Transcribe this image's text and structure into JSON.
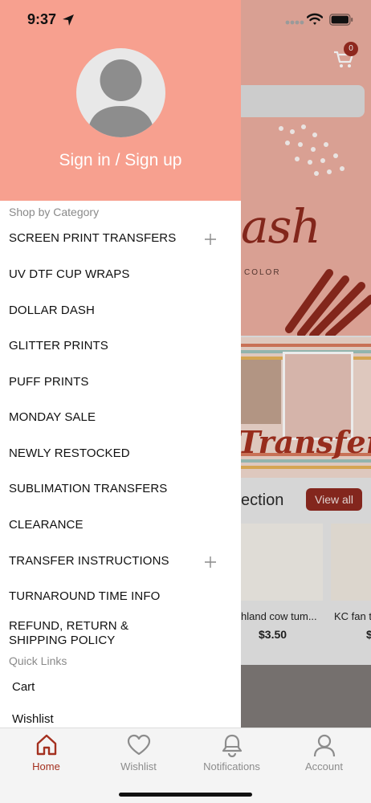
{
  "status_bar": {
    "time": "9:37"
  },
  "background": {
    "cart_badge": "0",
    "banner_word": "ash",
    "banner_subtext": "COLOR",
    "transfers_word": "Transfers",
    "section_title": "ection",
    "view_all_label": "View all",
    "products": [
      {
        "name": "hland cow tum...",
        "price": "$3.50"
      },
      {
        "name": "KC fan t",
        "price": "$"
      }
    ]
  },
  "drawer": {
    "sign_in_label": "Sign in / Sign up",
    "shop_by_category_label": "Shop by Category",
    "categories": [
      {
        "label": "SCREEN PRINT TRANSFERS",
        "expandable": true
      },
      {
        "label": "UV DTF CUP WRAPS",
        "expandable": false
      },
      {
        "label": "DOLLAR DASH",
        "expandable": false
      },
      {
        "label": "GLITTER PRINTS",
        "expandable": false
      },
      {
        "label": "PUFF PRINTS",
        "expandable": false
      },
      {
        "label": "MONDAY SALE",
        "expandable": false
      },
      {
        "label": "NEWLY RESTOCKED",
        "expandable": false
      },
      {
        "label": "SUBLIMATION TRANSFERS",
        "expandable": false
      },
      {
        "label": "CLEARANCE",
        "expandable": false
      },
      {
        "label": "TRANSFER INSTRUCTIONS",
        "expandable": true
      },
      {
        "label": "TURNAROUND TIME INFO",
        "expandable": false
      },
      {
        "label_line1": "REFUND, RETURN &",
        "label_line2": "SHIPPING POLICY",
        "expandable": false
      }
    ],
    "quick_links_label": "Quick Links",
    "quick_links": [
      {
        "label": "Cart"
      },
      {
        "label": "Wishlist"
      }
    ]
  },
  "tab_bar": {
    "tabs": [
      {
        "label": "Home",
        "icon": "home-icon",
        "active": true
      },
      {
        "label": "Wishlist",
        "icon": "heart-icon",
        "active": false
      },
      {
        "label": "Notifications",
        "icon": "bell-icon",
        "active": false
      },
      {
        "label": "Account",
        "icon": "person-icon",
        "active": false
      }
    ]
  },
  "colors": {
    "drawer_header": "#f7a08f",
    "accent": "#a4301f",
    "inactive_tab": "#8c8c8c"
  }
}
